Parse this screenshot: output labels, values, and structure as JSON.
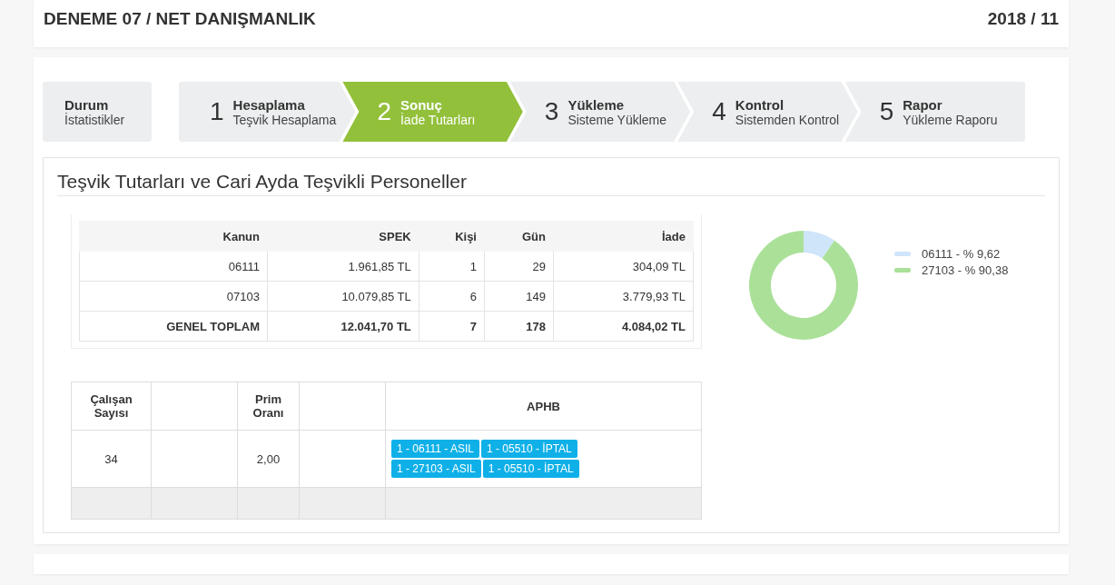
{
  "header": {
    "title": "DENEME 07 / NET DANIŞMANLIK",
    "period": "2018 / 11"
  },
  "status_tab": {
    "title": "Durum",
    "subtitle": "İstatistikler"
  },
  "steps": [
    {
      "number": "1",
      "title": "Hesaplama",
      "subtitle": "Teşvik Hesaplama",
      "selected": false
    },
    {
      "number": "2",
      "title": "Sonuç",
      "subtitle": "İade Tutarları",
      "selected": true
    },
    {
      "number": "3",
      "title": "Yükleme",
      "subtitle": "Sisteme Yükleme",
      "selected": false
    },
    {
      "number": "4",
      "title": "Kontrol",
      "subtitle": "Sistemden Kontrol",
      "selected": false
    },
    {
      "number": "5",
      "title": "Rapor",
      "subtitle": "Yükleme Raporu",
      "selected": false
    }
  ],
  "panel": {
    "title": "Teşvik Tutarları ve Cari Ayda Teşvikli Personeller"
  },
  "summary_table": {
    "columns": [
      "Kanun",
      "SPEK",
      "Kişi",
      "Gün",
      "İade"
    ],
    "rows": [
      [
        "06111",
        "1.961,85 TL",
        "1",
        "29",
        "304,09 TL"
      ],
      [
        "07103",
        "10.079,85 TL",
        "6",
        "149",
        "3.779,93 TL"
      ]
    ],
    "total": [
      "GENEL TOPLAM",
      "12.041,70 TL",
      "7",
      "178",
      "4.084,02 TL"
    ]
  },
  "chart": {
    "chart_data": {
      "type": "donut",
      "categories": [
        "06111 - % 9,62",
        "27103 - % 90,38"
      ],
      "values": [
        9.62,
        90.38
      ],
      "legend": "right"
    },
    "slices": [
      {
        "color": "#cfe5fa"
      },
      {
        "color": "#abe099"
      }
    ]
  },
  "employee_table": {
    "columns": [
      "Çalışan Sayısı",
      "",
      "Prim Oranı",
      "",
      "APHB"
    ],
    "row": {
      "count": "34",
      "rate": "2,00",
      "badges": [
        "1 - 06111 - ASIL",
        "1 - 05510 - İPTAL",
        "1 - 27103 - ASIL",
        "1 - 05510 - İPTAL"
      ]
    }
  }
}
